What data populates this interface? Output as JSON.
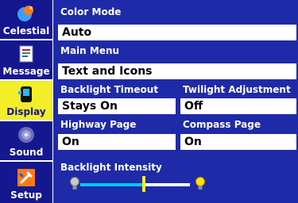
{
  "sidebar": {
    "items": [
      {
        "label": "Celestial",
        "icon": "celestial-icon",
        "active": false
      },
      {
        "label": "Message",
        "icon": "message-icon",
        "active": false
      },
      {
        "label": "Display",
        "icon": "display-icon",
        "active": true
      },
      {
        "label": "Sound",
        "icon": "sound-icon",
        "active": false
      },
      {
        "label": "Setup",
        "icon": "setup-icon",
        "active": false
      }
    ]
  },
  "settings": {
    "color_mode": {
      "label": "Color Mode",
      "value": "Auto"
    },
    "main_menu": {
      "label": "Main Menu",
      "value": "Text and Icons"
    },
    "backlight_timeout": {
      "label": "Backlight Timeout",
      "value": "Stays On"
    },
    "twilight_adjustment": {
      "label": "Twilight Adjustment",
      "value": "Off"
    },
    "highway_page": {
      "label": "Highway Page",
      "value": "On"
    },
    "compass_page": {
      "label": "Compass Page",
      "value": "On"
    },
    "backlight_intensity": {
      "label": "Backlight Intensity",
      "level": 0.58
    }
  },
  "colors": {
    "panel_bg": "#1f2aa8",
    "tab_bg": "#15178f",
    "active_tab_bg": "#f2ee2a",
    "slider_fill": "#00c8ff"
  }
}
